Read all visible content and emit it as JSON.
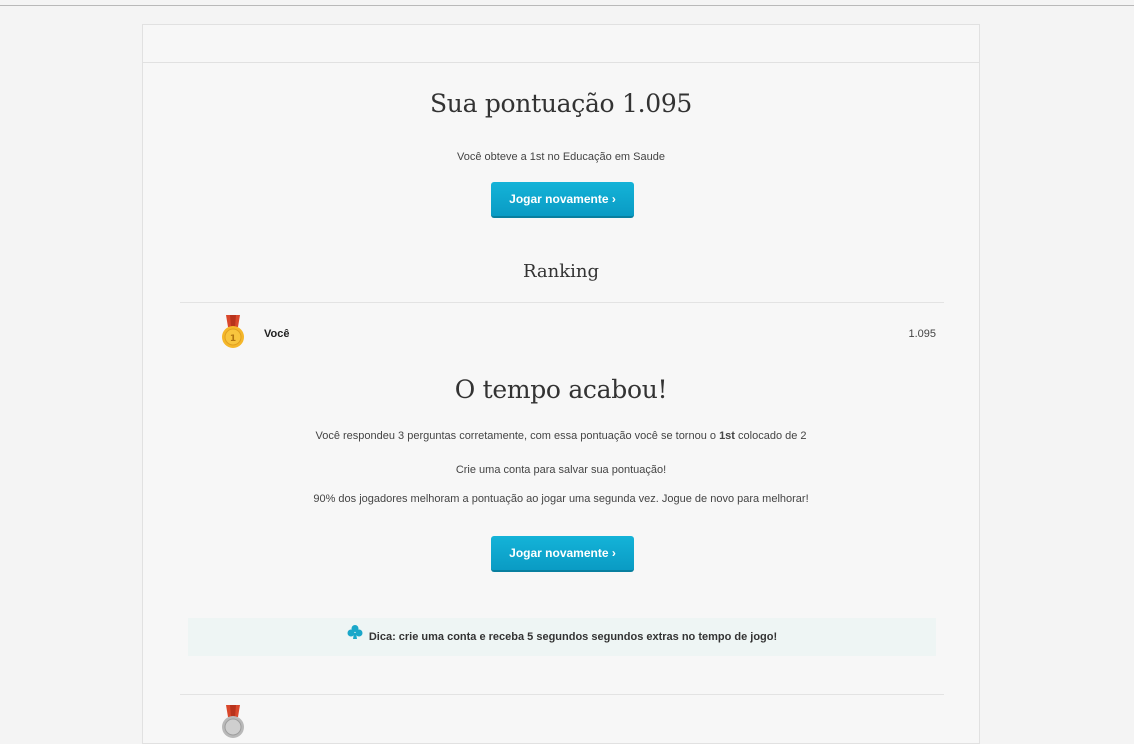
{
  "result": {
    "score_title": "Sua pontuação 1.095",
    "obtained_text": "Você obteve a 1st no Educação em Saude",
    "play_again_label": "Jogar novamente ›"
  },
  "ranking": {
    "title": "Ranking",
    "rows": [
      {
        "name": "Você",
        "score": "1.095",
        "medal": "gold-medal"
      },
      {
        "name": "",
        "score": "",
        "medal": "silver-medal"
      }
    ]
  },
  "time_up": {
    "title": "O tempo acabou!",
    "answered_prefix": "Você respondeu 3 perguntas corretamente, com essa pontuação você se tornou o ",
    "answered_rank": "1st",
    "answered_suffix": " colocado de 2",
    "create_account_text": "Crie uma conta para salvar sua pontuação!",
    "improve_text": "90% dos jogadores melhoram a pontuação ao jogar uma segunda vez. Jogue de novo para melhorar!",
    "play_again_label": "Jogar novamente ›"
  },
  "tip": {
    "icon": "club-icon",
    "text": "Dica: crie uma conta e receba 5 segundos segundos extras no tempo de jogo!"
  },
  "colors": {
    "button": "#0fa8d0",
    "tip_bg": "#eef5f4",
    "tip_icon": "#1aa7c9"
  }
}
